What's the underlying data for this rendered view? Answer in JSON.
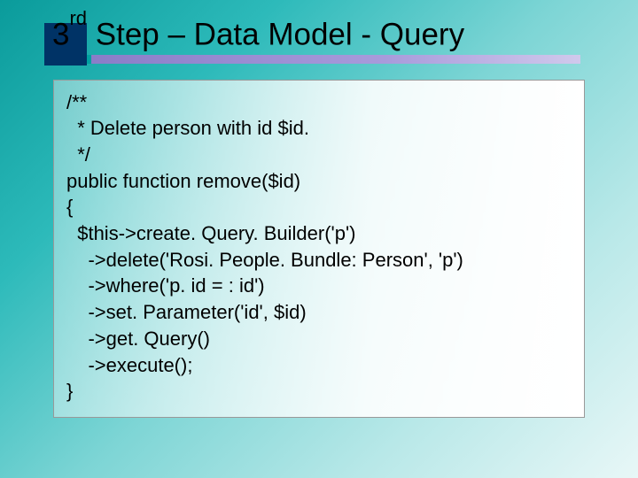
{
  "title": {
    "ord": "3",
    "sup": "rd",
    "rest": " Step – Data Model - Query"
  },
  "code": {
    "l1": "/**",
    "l2": "  * Delete person with id $id.",
    "l3": "  */",
    "l4": "public function remove($id)",
    "l5": "{",
    "l6": "  $this->create. Query. Builder('p')",
    "l7": "    ->delete('Rosi. People. Bundle: Person', 'p')",
    "l8": "    ->where('p. id = : id')",
    "l9": "    ->set. Parameter('id', $id)",
    "l10": "    ->get. Query()",
    "l11": "    ->execute();",
    "l12": "}"
  }
}
